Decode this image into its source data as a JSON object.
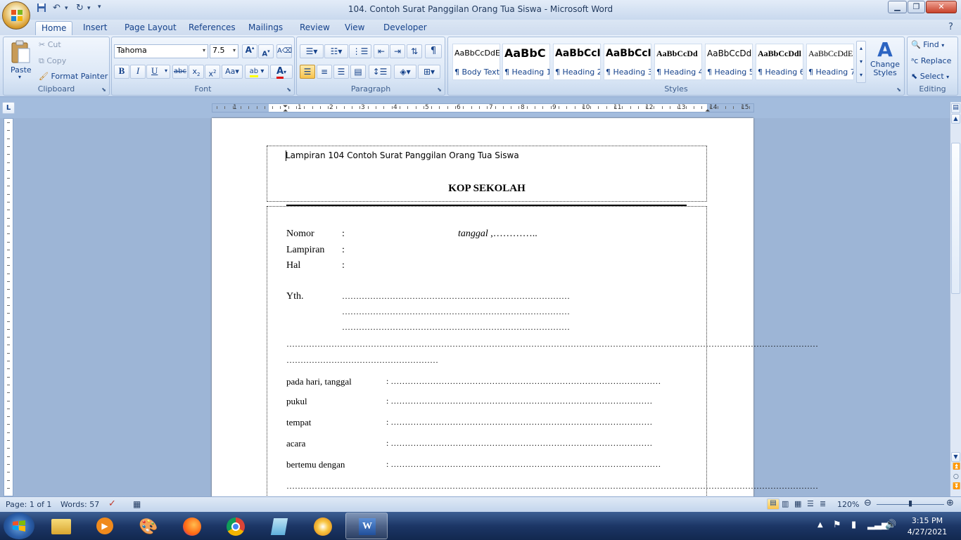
{
  "window": {
    "title": "104. Contoh Surat Panggilan Orang Tua Siswa - Microsoft Word"
  },
  "tabs": [
    "Home",
    "Insert",
    "Page Layout",
    "References",
    "Mailings",
    "Review",
    "View",
    "Developer"
  ],
  "clipboard": {
    "paste": "Paste",
    "cut": "Cut",
    "copy": "Copy",
    "format_painter": "Format Painter",
    "label": "Clipboard"
  },
  "font": {
    "name": "Tahoma",
    "size": "7.5",
    "label": "Font"
  },
  "paragraph": {
    "label": "Paragraph"
  },
  "styles": {
    "label": "Styles",
    "items": [
      {
        "sample": "AaBbCcDdEe",
        "name": "¶ Body Text"
      },
      {
        "sample": "AaBbC",
        "name": "¶ Heading 1"
      },
      {
        "sample": "AaBbCcI",
        "name": "¶ Heading 2"
      },
      {
        "sample": "AaBbCcI",
        "name": "¶ Heading 3"
      },
      {
        "sample": "AaBbCcDd",
        "name": "¶ Heading 4"
      },
      {
        "sample": "AaBbCcDd",
        "name": "¶ Heading 5"
      },
      {
        "sample": "AaBbCcDdl",
        "name": "¶ Heading 6"
      },
      {
        "sample": "AaBbCcDdE",
        "name": "¶ Heading 7"
      }
    ],
    "change_styles": "Change Styles"
  },
  "editing": {
    "find": "Find",
    "replace": "Replace",
    "select": "Select",
    "label": "Editing"
  },
  "ruler": {
    "numbers": [
      "1",
      "1",
      "2",
      "3",
      "4",
      "5",
      "6",
      "7",
      "8",
      "9",
      "10",
      "11",
      "12",
      "13",
      "14",
      "15"
    ]
  },
  "document": {
    "header": "Lampiran 104 Contoh Surat Panggilan Orang Tua Siswa",
    "kop": "KOP SEKOLAH",
    "nomor_label": "Nomor",
    "lampiran_label": "Lampiran",
    "hal_label": "Hal",
    "colon": ":",
    "tanggal": "tanggal",
    "tanggal_dots": " ,…………..",
    "yth_label": "Yth.",
    "yth_dots": "………………………………………………………………………",
    "long_dots_1": "………………………………………………………………………………………………………………………………………………………………………",
    "long_dots_2": "………………………………………………",
    "fields": [
      {
        "label": "pada hari, tanggal",
        "value": ": ……………………………………………………………………………………"
      },
      {
        "label": "pukul",
        "value": ":   …………………………………………………………………………………"
      },
      {
        "label": "tempat",
        "value": ":   …………………………………………………………………………………"
      },
      {
        "label": "acara",
        "value": ": …………………………………………………………………………………"
      },
      {
        "label": "bertemu dengan",
        "value": ": ……………………………………………………………………………………"
      }
    ]
  },
  "status": {
    "page": "Page: 1 of 1",
    "words": "Words: 57",
    "zoom": "120%"
  },
  "taskbar": {
    "time": "3:15 PM",
    "date": "4/27/2021"
  },
  "colors": {
    "ribbon": "#dbe7f6",
    "taskbar": "#1c3666",
    "accent": "#15428b"
  }
}
